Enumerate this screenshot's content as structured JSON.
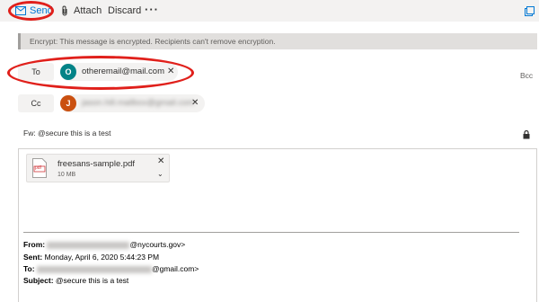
{
  "toolbar": {
    "send_label": "Send",
    "attach_label": "Attach",
    "discard_label": "Discard",
    "more_icon": "ellipsis-icon",
    "popout_icon": "popout-icon"
  },
  "notice": {
    "text": "Encrypt: This message is encrypted. Recipients can't remove encryption."
  },
  "recipients": {
    "to_label": "To",
    "to": [
      {
        "initial": "O",
        "email": "otheremail@mail.com",
        "color": "#038387"
      }
    ],
    "cc_label": "Cc",
    "cc": [
      {
        "initial": "J",
        "email": "jason.hill.mailbox@gmail.com",
        "color": "#ca5010"
      }
    ],
    "bcc_label": "Bcc"
  },
  "subject": "Fw: @secure this is a test",
  "attachment": {
    "name": "freesans-sample.pdf",
    "size": "10 MB",
    "type_label": "pdf"
  },
  "forwarded": {
    "from_label": "From:",
    "from_domain": "@nycourts.gov>",
    "sent_label": "Sent:",
    "sent_value": "Monday, April 6, 2020 5:44:23 PM",
    "to_label": "To:",
    "to_domain": "@gmail.com>",
    "subject_label": "Subject:",
    "subject_value": "@secure this is a test"
  },
  "colors": {
    "accent": "#0078d4",
    "highlight_ring": "#e0201b"
  }
}
